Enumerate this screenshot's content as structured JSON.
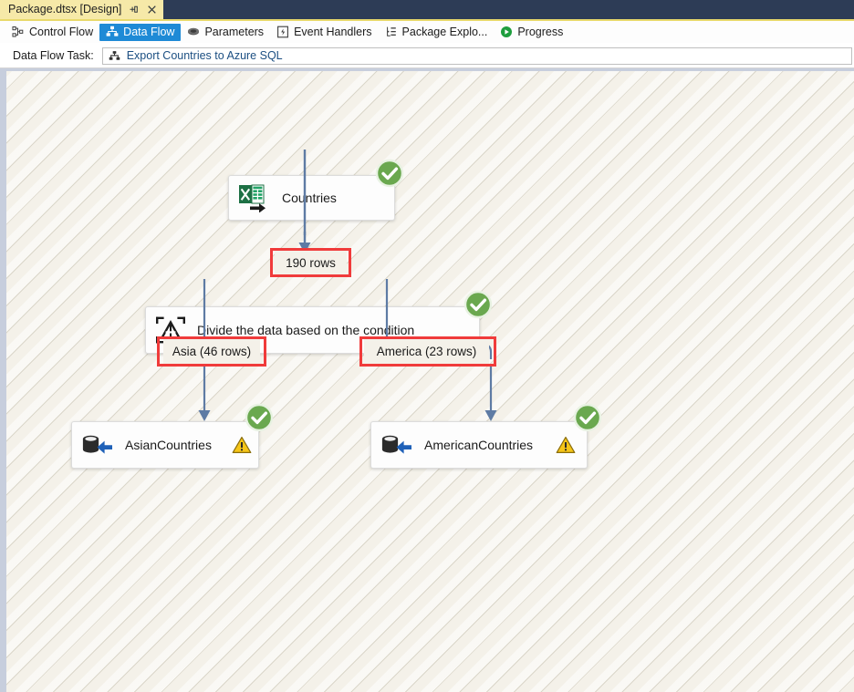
{
  "window": {
    "document_tab": {
      "title": "Package.dtsx [Design]",
      "pin_icon": "pin-icon",
      "close_icon": "close-icon"
    }
  },
  "designer_tabs": [
    {
      "label": "Control Flow",
      "icon": "control-flow-icon",
      "active": false
    },
    {
      "label": "Data Flow",
      "icon": "data-flow-icon",
      "active": true
    },
    {
      "label": "Parameters",
      "icon": "parameters-icon",
      "active": false
    },
    {
      "label": "Event Handlers",
      "icon": "event-handlers-icon",
      "active": false
    },
    {
      "label": "Package Explo...",
      "icon": "package-explorer-icon",
      "active": false
    },
    {
      "label": "Progress",
      "icon": "progress-icon",
      "active": false
    }
  ],
  "task_bar": {
    "label": "Data Flow Task:",
    "selected_task": "Export Countries to Azure SQL",
    "task_icon": "data-flow-task-icon"
  },
  "diagram": {
    "nodes": [
      {
        "id": "countries",
        "name": "Countries",
        "icon": "excel-source-icon",
        "status": "success",
        "has_warning": false
      },
      {
        "id": "conditional-split",
        "name": "Divide the data based on the condition",
        "icon": "conditional-split-icon",
        "status": "success",
        "has_warning": false
      },
      {
        "id": "asian-countries",
        "name": "AsianCountries",
        "icon": "ole-db-destination-icon",
        "status": "success",
        "has_warning": true
      },
      {
        "id": "american-countries",
        "name": "AmericanCountries",
        "icon": "ole-db-destination-icon",
        "status": "success",
        "has_warning": true
      }
    ],
    "path_labels": [
      {
        "id": "main-path",
        "text": "190 rows",
        "highlighted": true
      },
      {
        "id": "asia-path",
        "text": "Asia (46 rows)",
        "highlighted": true
      },
      {
        "id": "america-path",
        "text": "America (23 rows)",
        "highlighted": true
      }
    ]
  },
  "colors": {
    "titlebar": "#2d3c56",
    "tab_background": "#f6e9a8",
    "accent_underline": "#e8d96b",
    "active_tab": "#1e8ad6",
    "canvas": "#f4f1e9",
    "connector": "#5e7ba4",
    "success": "#6aa84f",
    "warning": "#f5c518",
    "highlight": "#f03b3b",
    "link_text": "#1c4f82"
  }
}
